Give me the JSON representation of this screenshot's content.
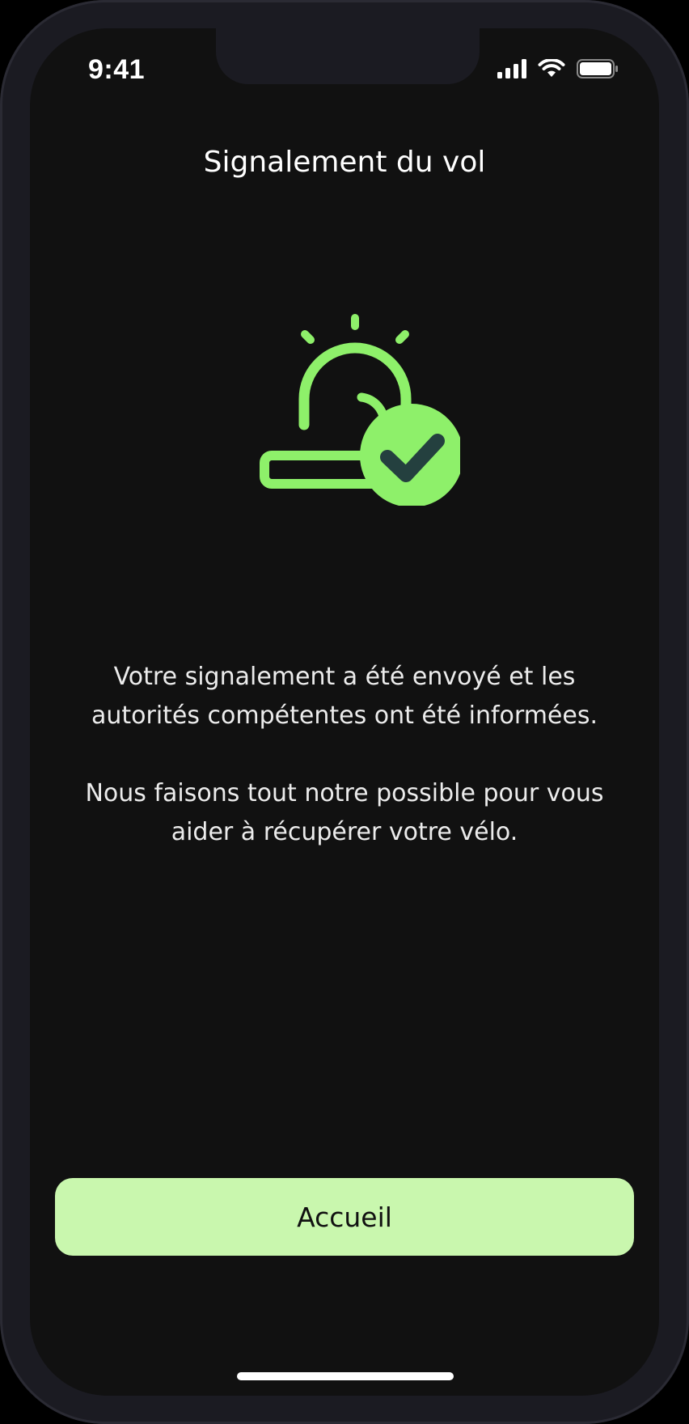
{
  "status_bar": {
    "time": "9:41"
  },
  "header": {
    "title": "Signalement du vol"
  },
  "illustration": {
    "icon": "siren-check-icon",
    "accent_color": "#8ef06a",
    "check_color": "#24403f"
  },
  "message": {
    "paragraph_1": "Votre signalement a été envoyé et les autorités compétentes ont été informées.",
    "paragraph_2": "Nous faisons tout notre possible pour vous aider à récupérer votre vélo."
  },
  "actions": {
    "home_label": "Accueil",
    "button_color": "#c9f7ae"
  }
}
